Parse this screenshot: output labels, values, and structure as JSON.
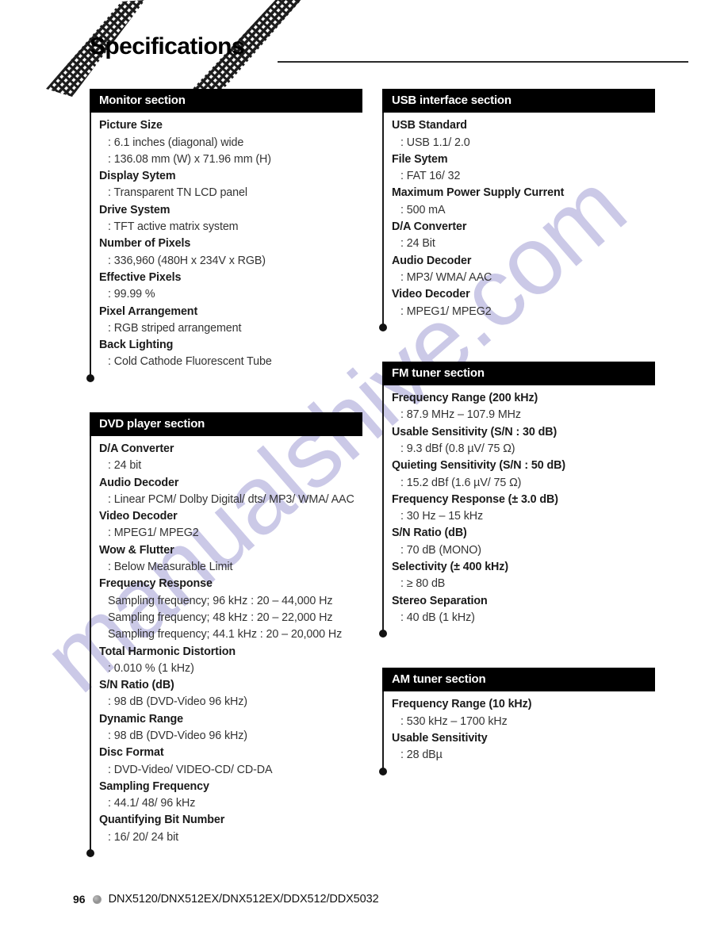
{
  "page": {
    "title": "Specifications",
    "watermark": "manualshive.com"
  },
  "footer": {
    "page_number": "96",
    "models": "DNX5120/DNX512EX/DNX512EX/DDX512/DDX5032"
  },
  "columns": {
    "left": [
      {
        "heading": "Monitor section",
        "entries": [
          {
            "term": "Picture Size",
            "values": [
              ": 6.1 inches (diagonal) wide",
              ": 136.08 mm (W) x 71.96 mm (H)"
            ]
          },
          {
            "term": "Display Sytem",
            "values": [
              ": Transparent TN LCD panel"
            ]
          },
          {
            "term": "Drive System",
            "values": [
              ": TFT active matrix system"
            ]
          },
          {
            "term": "Number of Pixels",
            "values": [
              ": 336,960 (480H x 234V x RGB)"
            ]
          },
          {
            "term": "Effective Pixels",
            "values": [
              ": 99.99 %"
            ]
          },
          {
            "term": "Pixel Arrangement",
            "values": [
              ": RGB striped arrangement"
            ]
          },
          {
            "term": "Back Lighting",
            "values": [
              ": Cold Cathode Fluorescent Tube"
            ]
          }
        ]
      },
      {
        "heading": "DVD player section",
        "entries": [
          {
            "term": "D/A Converter",
            "values": [
              ": 24 bit"
            ]
          },
          {
            "term": "Audio Decoder",
            "values": [
              ": Linear PCM/ Dolby Digital/ dts/ MP3/ WMA/ AAC"
            ]
          },
          {
            "term": "Video Decoder",
            "values": [
              ": MPEG1/ MPEG2"
            ]
          },
          {
            "term": "Wow & Flutter",
            "values": [
              ": Below Measurable Limit"
            ]
          },
          {
            "term": "Frequency Response",
            "values": [
              "Sampling frequency; 96 kHz : 20 – 44,000 Hz",
              "Sampling frequency; 48 kHz : 20 – 22,000 Hz",
              "Sampling frequency; 44.1 kHz : 20 – 20,000 Hz"
            ]
          },
          {
            "term": "Total Harmonic Distortion",
            "values": [
              ": 0.010 % (1 kHz)"
            ]
          },
          {
            "term": "S/N Ratio (dB)",
            "values": [
              ": 98 dB (DVD-Video 96 kHz)"
            ]
          },
          {
            "term": "Dynamic Range",
            "values": [
              ": 98 dB (DVD-Video 96 kHz)"
            ]
          },
          {
            "term": "Disc Format",
            "values": [
              ": DVD-Video/ VIDEO-CD/ CD-DA"
            ]
          },
          {
            "term": "Sampling Frequency",
            "values": [
              ": 44.1/ 48/ 96 kHz"
            ]
          },
          {
            "term": "Quantifying Bit Number",
            "values": [
              ": 16/ 20/ 24 bit"
            ]
          }
        ]
      }
    ],
    "right": [
      {
        "heading": "USB interface section",
        "entries": [
          {
            "term": "USB Standard",
            "values": [
              ": USB 1.1/ 2.0"
            ]
          },
          {
            "term": "File Sytem",
            "values": [
              ": FAT 16/ 32"
            ]
          },
          {
            "term": "Maximum Power Supply Current",
            "values": [
              ": 500 mA"
            ]
          },
          {
            "term": "D/A Converter",
            "values": [
              ": 24 Bit"
            ]
          },
          {
            "term": "Audio Decoder",
            "values": [
              ": MP3/ WMA/ AAC"
            ]
          },
          {
            "term": "Video Decoder",
            "values": [
              ": MPEG1/ MPEG2"
            ]
          }
        ]
      },
      {
        "heading": "FM tuner section",
        "entries": [
          {
            "term": "Frequency Range (200 kHz)",
            "values": [
              ": 87.9 MHz – 107.9 MHz"
            ]
          },
          {
            "term": "Usable Sensitivity (S/N : 30 dB)",
            "values": [
              ": 9.3 dBf (0.8 µV/ 75 Ω)"
            ]
          },
          {
            "term": "Quieting Sensitivity (S/N : 50 dB)",
            "values": [
              ": 15.2 dBf (1.6 µV/ 75 Ω)"
            ]
          },
          {
            "term": "Frequency Response (± 3.0 dB)",
            "values": [
              ": 30 Hz – 15 kHz"
            ]
          },
          {
            "term": "S/N Ratio (dB)",
            "values": [
              ": 70 dB (MONO)"
            ]
          },
          {
            "term": "Selectivity (± 400 kHz)",
            "values": [
              ": ≥ 80 dB"
            ]
          },
          {
            "term": "Stereo Separation",
            "values": [
              ": 40 dB (1 kHz)"
            ]
          }
        ]
      },
      {
        "heading": "AM tuner section",
        "entries": [
          {
            "term": "Frequency Range (10 kHz)",
            "values": [
              ": 530 kHz – 1700 kHz"
            ]
          },
          {
            "term": "Usable Sensitivity",
            "values": [
              ": 28 dBµ"
            ]
          }
        ]
      }
    ]
  }
}
